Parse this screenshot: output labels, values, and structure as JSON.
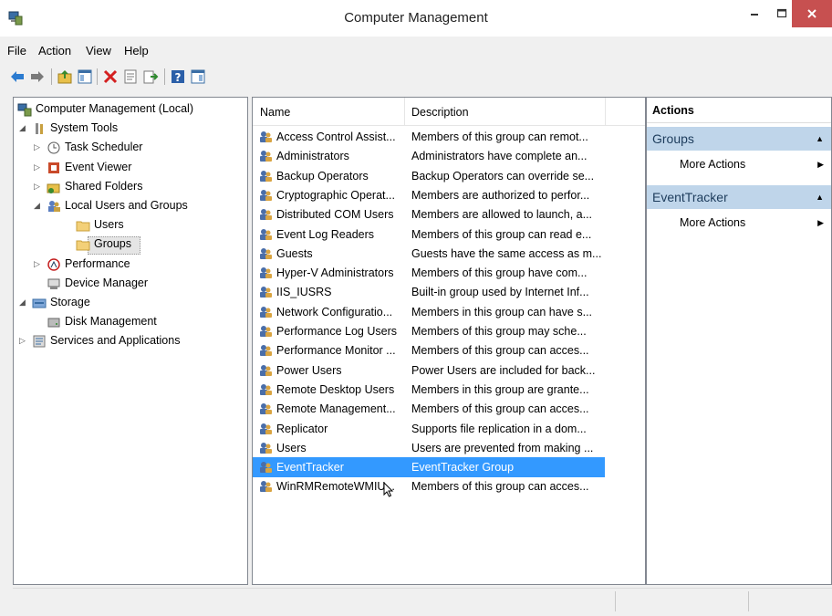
{
  "window": {
    "title": "Computer Management"
  },
  "menu": [
    "File",
    "Action",
    "View",
    "Help"
  ],
  "tree": {
    "items": [
      {
        "label": "Computer Management (Local)",
        "icon": "computer-management-icon",
        "level": 0,
        "expander": ""
      },
      {
        "label": "System Tools",
        "icon": "tools-icon",
        "level": 1,
        "expander": "expanded"
      },
      {
        "label": "Task Scheduler",
        "icon": "clock-icon",
        "level": 2,
        "expander": "collapsed"
      },
      {
        "label": "Event Viewer",
        "icon": "event-viewer-icon",
        "level": 2,
        "expander": "collapsed"
      },
      {
        "label": "Shared Folders",
        "icon": "shared-folder-icon",
        "level": 2,
        "expander": "collapsed"
      },
      {
        "label": "Local Users and Groups",
        "icon": "users-icon",
        "level": 2,
        "expander": "expanded"
      },
      {
        "label": "Users",
        "icon": "folder-icon",
        "level": 3,
        "expander": ""
      },
      {
        "label": "Groups",
        "icon": "folder-icon",
        "level": 3,
        "expander": "",
        "selected": true
      },
      {
        "label": "Performance",
        "icon": "performance-icon",
        "level": 2,
        "expander": "collapsed"
      },
      {
        "label": "Device Manager",
        "icon": "device-manager-icon",
        "level": 2,
        "expander": ""
      },
      {
        "label": "Storage",
        "icon": "storage-icon",
        "level": 1,
        "expander": "expanded"
      },
      {
        "label": "Disk Management",
        "icon": "disk-icon",
        "level": 2,
        "expander": ""
      },
      {
        "label": "Services and Applications",
        "icon": "services-icon",
        "level": 1,
        "expander": "collapsed"
      }
    ]
  },
  "list": {
    "columns": [
      "Name",
      "Description"
    ],
    "rows": [
      {
        "name": "Access Control Assist...",
        "description": "Members of this group can remot..."
      },
      {
        "name": "Administrators",
        "description": "Administrators have complete an..."
      },
      {
        "name": "Backup Operators",
        "description": "Backup Operators can override se..."
      },
      {
        "name": "Cryptographic Operat...",
        "description": "Members are authorized to perfor..."
      },
      {
        "name": "Distributed COM Users",
        "description": "Members are allowed to launch, a..."
      },
      {
        "name": "Event Log Readers",
        "description": "Members of this group can read e..."
      },
      {
        "name": "Guests",
        "description": "Guests have the same access as m..."
      },
      {
        "name": "Hyper-V Administrators",
        "description": "Members of this group have com..."
      },
      {
        "name": "IIS_IUSRS",
        "description": "Built-in group used by Internet Inf..."
      },
      {
        "name": "Network Configuratio...",
        "description": "Members in this group can have s..."
      },
      {
        "name": "Performance Log Users",
        "description": "Members of this group may sche..."
      },
      {
        "name": "Performance Monitor ...",
        "description": "Members of this group can acces..."
      },
      {
        "name": "Power Users",
        "description": "Power Users are included for back..."
      },
      {
        "name": "Remote Desktop Users",
        "description": "Members in this group are grante..."
      },
      {
        "name": "Remote Management...",
        "description": "Members of this group can acces..."
      },
      {
        "name": "Replicator",
        "description": "Supports file replication in a dom..."
      },
      {
        "name": "Users",
        "description": "Users are prevented from making ..."
      },
      {
        "name": "EventTracker",
        "description": "EventTracker Group",
        "selected": true
      },
      {
        "name": "WinRMRemoteWMIU...",
        "description": "Members of this group can acces..."
      }
    ]
  },
  "actions": {
    "header": "Actions",
    "sections": [
      {
        "title": "Groups",
        "item": "More Actions"
      },
      {
        "title": "EventTracker",
        "item": "More Actions"
      }
    ]
  },
  "colors": {
    "selection": "#3399ff",
    "action_section": "#bfd5ea",
    "close_button": "#c75050"
  }
}
